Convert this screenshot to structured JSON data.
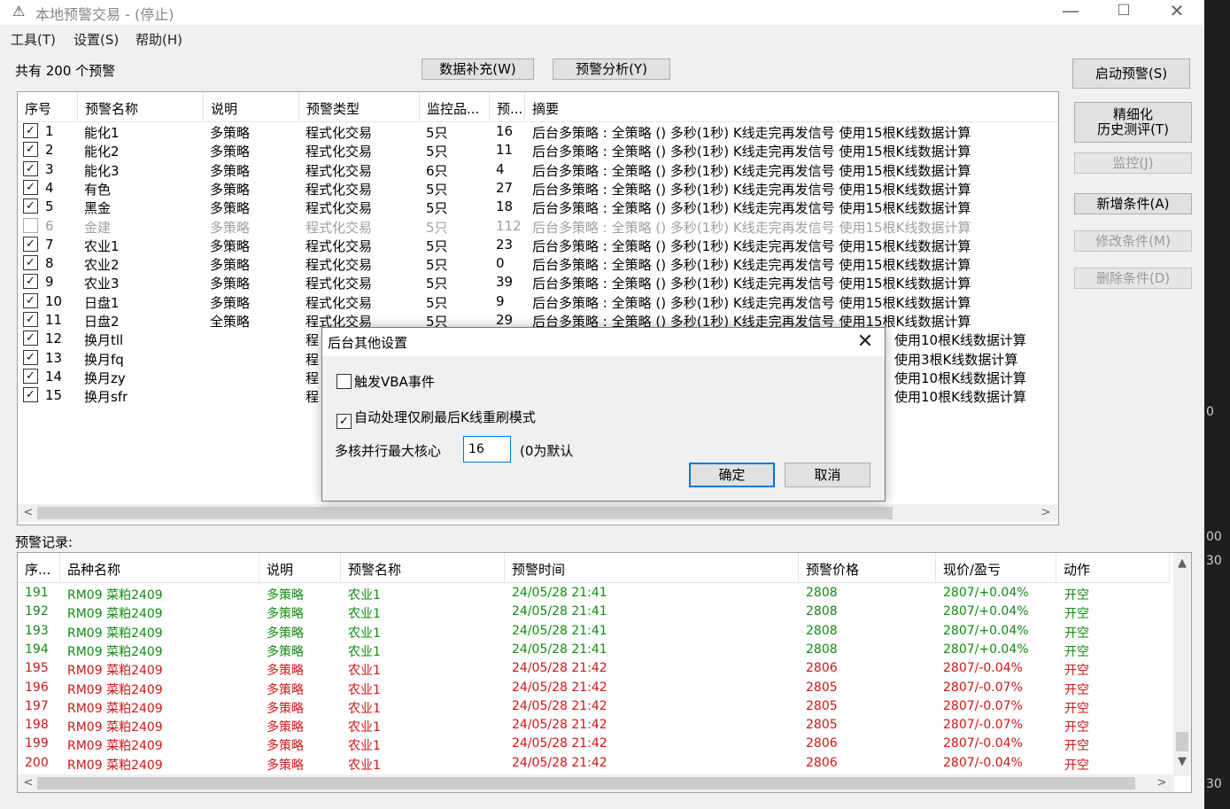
{
  "window": {
    "title": "本地预警交易 - (停止)",
    "controls": {
      "minimize": "—",
      "maximize": "☐",
      "close": "✕"
    }
  },
  "menu": [
    "工具(T)",
    "设置(S)",
    "帮助(H)"
  ],
  "toolbar": {
    "count_label": "共有 200 个预警",
    "data_fill": "数据补充(W)",
    "alert_analysis": "预警分析(Y)"
  },
  "side_buttons": {
    "start": "启动预警(S)",
    "backtest_line1": "精细化",
    "backtest_line2": "历史测评(T)",
    "monitor": "监控(J)",
    "add": "新增条件(A)",
    "modify": "修改条件(M)",
    "delete": "删除条件(D)"
  },
  "alert_table": {
    "columns": [
      "序号",
      "预警名称",
      "说明",
      "预警类型",
      "监控品...",
      "预...",
      "摘要"
    ],
    "rows": [
      {
        "checked": true,
        "no": "1",
        "name": "能化1",
        "desc": "多策略",
        "type": "程式化交易",
        "monitor": "5只",
        "count": "16",
        "summary": "后台多策略 : 全策略 () 多秒(1秒) K线走完再发信号 使用15根K线数据计算"
      },
      {
        "checked": true,
        "no": "2",
        "name": "能化2",
        "desc": "多策略",
        "type": "程式化交易",
        "monitor": "5只",
        "count": "11",
        "summary": "后台多策略 : 全策略 () 多秒(1秒) K线走完再发信号 使用15根K线数据计算"
      },
      {
        "checked": true,
        "no": "3",
        "name": "能化3",
        "desc": "多策略",
        "type": "程式化交易",
        "monitor": "6只",
        "count": "4",
        "summary": "后台多策略 : 全策略 () 多秒(1秒) K线走完再发信号 使用15根K线数据计算"
      },
      {
        "checked": true,
        "no": "4",
        "name": "有色",
        "desc": "多策略",
        "type": "程式化交易",
        "monitor": "5只",
        "count": "27",
        "summary": "后台多策略 : 全策略 () 多秒(1秒) K线走完再发信号 使用15根K线数据计算"
      },
      {
        "checked": true,
        "no": "5",
        "name": "黑金",
        "desc": "多策略",
        "type": "程式化交易",
        "monitor": "5只",
        "count": "18",
        "summary": "后台多策略 : 全策略 () 多秒(1秒) K线走完再发信号 使用15根K线数据计算"
      },
      {
        "checked": false,
        "no": "6",
        "name": "金建",
        "desc": "多策略",
        "type": "程式化交易",
        "monitor": "5只",
        "count": "112",
        "summary": "后台多策略 : 全策略 () 多秒(1秒) K线走完再发信号 使用15根K线数据计算"
      },
      {
        "checked": true,
        "no": "7",
        "name": "农业1",
        "desc": "多策略",
        "type": "程式化交易",
        "monitor": "5只",
        "count": "23",
        "summary": "后台多策略 : 全策略 () 多秒(1秒) K线走完再发信号 使用15根K线数据计算"
      },
      {
        "checked": true,
        "no": "8",
        "name": "农业2",
        "desc": "多策略",
        "type": "程式化交易",
        "monitor": "5只",
        "count": "0",
        "summary": "后台多策略 : 全策略 () 多秒(1秒) K线走完再发信号 使用15根K线数据计算"
      },
      {
        "checked": true,
        "no": "9",
        "name": "农业3",
        "desc": "多策略",
        "type": "程式化交易",
        "monitor": "5只",
        "count": "39",
        "summary": "后台多策略 : 全策略 () 多秒(1秒) K线走完再发信号 使用15根K线数据计算"
      },
      {
        "checked": true,
        "no": "10",
        "name": "日盘1",
        "desc": "多策略",
        "type": "程式化交易",
        "monitor": "5只",
        "count": "9",
        "summary": "后台多策略 : 全策略 () 多秒(1秒) K线走完再发信号 使用15根K线数据计算"
      },
      {
        "checked": true,
        "no": "11",
        "name": "日盘2",
        "desc": "全策略",
        "type": "程式化交易",
        "monitor": "5只",
        "count": "29",
        "summary": "后台多策略 : 全策略 () 多秒(1秒) K线走完再发信号 使用15根K线数据计算"
      },
      {
        "checked": true,
        "no": "12",
        "name": "换月tll",
        "desc": "",
        "type": "程",
        "monitor": "",
        "count": "",
        "summary": "使用10根K线数据计算"
      },
      {
        "checked": true,
        "no": "13",
        "name": "换月fq",
        "desc": "",
        "type": "程",
        "monitor": "",
        "count": "",
        "summary": "使用3根K线数据计算"
      },
      {
        "checked": true,
        "no": "14",
        "name": "换月zy",
        "desc": "",
        "type": "程",
        "monitor": "",
        "count": "",
        "summary": "使用10根K线数据计算"
      },
      {
        "checked": true,
        "no": "15",
        "name": "换月sfr",
        "desc": "",
        "type": "程",
        "monitor": "",
        "count": "",
        "summary": "使用10根K线数据计算"
      }
    ]
  },
  "log": {
    "label": "预警记录:",
    "columns": [
      "序...",
      "品种名称",
      "说明",
      "预警名称",
      "预警时间",
      "预警价格",
      "现价/盈亏",
      "动作"
    ],
    "rows": [
      {
        "no": "191",
        "product": "RM09 菜粕2409",
        "desc": "多策略",
        "alert": "农业1",
        "time": "24/05/28 21:41",
        "price": "2808",
        "pnl": "2807/+0.04%",
        "action": "开空",
        "color": "green"
      },
      {
        "no": "192",
        "product": "RM09 菜粕2409",
        "desc": "多策略",
        "alert": "农业1",
        "time": "24/05/28 21:41",
        "price": "2808",
        "pnl": "2807/+0.04%",
        "action": "开空",
        "color": "green"
      },
      {
        "no": "193",
        "product": "RM09 菜粕2409",
        "desc": "多策略",
        "alert": "农业1",
        "time": "24/05/28 21:41",
        "price": "2808",
        "pnl": "2807/+0.04%",
        "action": "开空",
        "color": "green"
      },
      {
        "no": "194",
        "product": "RM09 菜粕2409",
        "desc": "多策略",
        "alert": "农业1",
        "time": "24/05/28 21:41",
        "price": "2808",
        "pnl": "2807/+0.04%",
        "action": "开空",
        "color": "green"
      },
      {
        "no": "195",
        "product": "RM09 菜粕2409",
        "desc": "多策略",
        "alert": "农业1",
        "time": "24/05/28 21:42",
        "price": "2806",
        "pnl": "2807/-0.04%",
        "action": "开空",
        "color": "red"
      },
      {
        "no": "196",
        "product": "RM09 菜粕2409",
        "desc": "多策略",
        "alert": "农业1",
        "time": "24/05/28 21:42",
        "price": "2805",
        "pnl": "2807/-0.07%",
        "action": "开空",
        "color": "red"
      },
      {
        "no": "197",
        "product": "RM09 菜粕2409",
        "desc": "多策略",
        "alert": "农业1",
        "time": "24/05/28 21:42",
        "price": "2805",
        "pnl": "2807/-0.07%",
        "action": "开空",
        "color": "red"
      },
      {
        "no": "198",
        "product": "RM09 菜粕2409",
        "desc": "多策略",
        "alert": "农业1",
        "time": "24/05/28 21:42",
        "price": "2805",
        "pnl": "2807/-0.07%",
        "action": "开空",
        "color": "red"
      },
      {
        "no": "199",
        "product": "RM09 菜粕2409",
        "desc": "多策略",
        "alert": "农业1",
        "time": "24/05/28 21:42",
        "price": "2806",
        "pnl": "2807/-0.04%",
        "action": "开空",
        "color": "red"
      },
      {
        "no": "200",
        "product": "RM09 菜粕2409",
        "desc": "多策略",
        "alert": "农业1",
        "time": "24/05/28 21:42",
        "price": "2806",
        "pnl": "2807/-0.04%",
        "action": "开空",
        "color": "red"
      }
    ]
  },
  "dialog": {
    "title": "后台其他设置",
    "vba_label": "触发VBA事件",
    "vba_checked": false,
    "auto_label": "自动处理仅刷最后K线重刷模式",
    "auto_checked": true,
    "cores_label": "多核并行最大核心",
    "cores_value": "16",
    "cores_hint": "(0为默认",
    "ok": "确定",
    "cancel": "取消"
  },
  "background_text": [
    "0",
    "00",
    "30",
    "30"
  ],
  "colors": {
    "profit_green": "#128c12",
    "loss_red": "#d01616",
    "focus_blue": "#0078d7"
  }
}
